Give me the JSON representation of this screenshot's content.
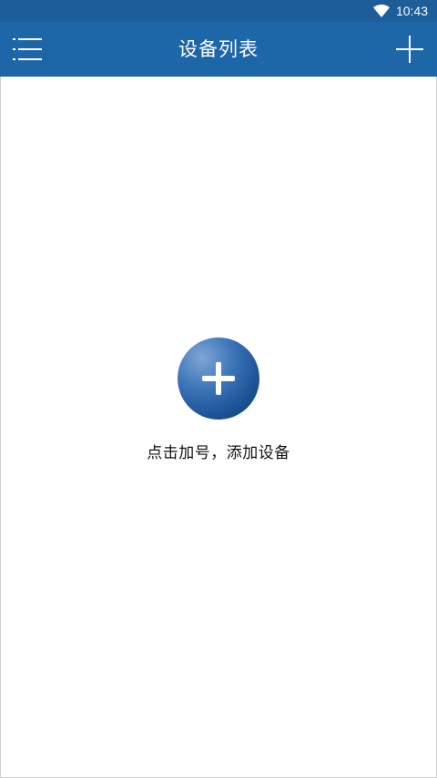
{
  "status_bar": {
    "time": "10:43",
    "wifi_icon": "wifi-icon"
  },
  "app_bar": {
    "title": "设备列表",
    "menu_icon": "menu-icon",
    "add_icon": "plus-icon"
  },
  "empty_state": {
    "add_button_icon": "plus-icon",
    "hint": "点击加号，添加设备"
  },
  "colors": {
    "status_bar": "#1c5d9a",
    "app_bar": "#1d67a8",
    "accent": "#1c5296",
    "background": "#ffffff"
  }
}
